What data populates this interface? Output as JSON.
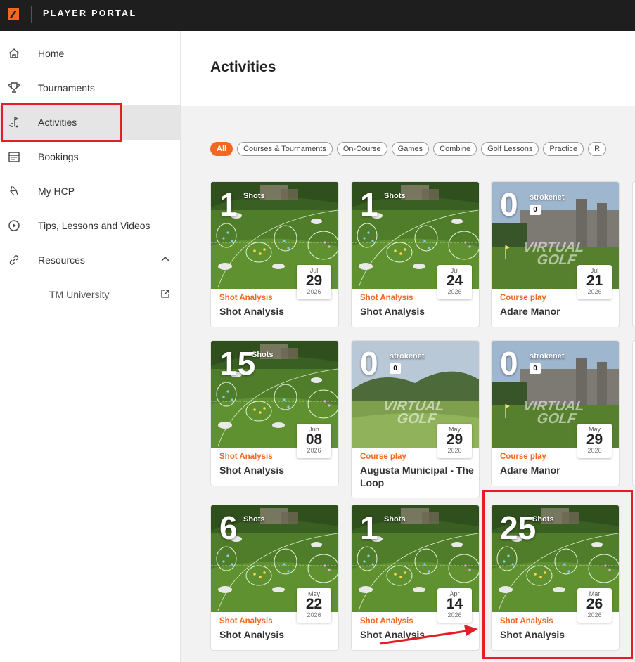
{
  "header": {
    "title": "PLAYER PORTAL",
    "logo_icon": "trackman-logo-icon",
    "brand_color": "#f26822"
  },
  "sidebar": {
    "items": [
      {
        "label": "Home",
        "icon": "home-icon"
      },
      {
        "label": "Tournaments",
        "icon": "trophy-icon"
      },
      {
        "label": "Activities",
        "icon": "activities-icon",
        "active": true
      },
      {
        "label": "Bookings",
        "icon": "calendar-icon"
      },
      {
        "label": "My HCP",
        "icon": "hcp-icon"
      },
      {
        "label": "Tips, Lessons and Videos",
        "icon": "play-circle-icon"
      },
      {
        "label": "Resources",
        "icon": "link-icon",
        "expanded": true
      }
    ],
    "subitems": [
      {
        "label": "TM University",
        "icon": "external-link-icon"
      }
    ]
  },
  "main": {
    "title": "Activities",
    "filters": [
      "All",
      "Courses & Tournaments",
      "On-Course",
      "Games",
      "Combine",
      "Golf Lessons",
      "Practice",
      "R"
    ],
    "cards": [
      {
        "type": "shots",
        "number": "1",
        "label": "Shots",
        "month": "Jul",
        "day": "29",
        "year": "2026",
        "category": "Shot Analysis",
        "name": "Shot Analysis"
      },
      {
        "type": "shots",
        "number": "1",
        "label": "Shots",
        "month": "Jul",
        "day": "24",
        "year": "2026",
        "category": "Shot Analysis",
        "name": "Shot Analysis"
      },
      {
        "type": "course",
        "number": "0",
        "label": "strokenet",
        "score": "0",
        "scene": "manor",
        "month": "Jul",
        "day": "21",
        "year": "2026",
        "category": "Course play",
        "name": "Adare Manor"
      },
      {
        "type": "shots",
        "number": "15",
        "label": "Shots",
        "month": "Jun",
        "day": "08",
        "year": "2026",
        "category": "Shot Analysis",
        "name": "Shot Analysis"
      },
      {
        "type": "course",
        "number": "0",
        "label": "strokenet",
        "score": "0",
        "scene": "augusta",
        "month": "May",
        "day": "29",
        "year": "2026",
        "category": "Course play",
        "name": "Augusta Municipal - The Loop"
      },
      {
        "type": "course",
        "number": "0",
        "label": "strokenet",
        "score": "0",
        "scene": "manor",
        "month": "May",
        "day": "29",
        "year": "2026",
        "category": "Course play",
        "name": "Adare Manor"
      },
      {
        "type": "shots",
        "number": "6",
        "label": "Shots",
        "month": "May",
        "day": "22",
        "year": "2026",
        "category": "Shot Analysis",
        "name": "Shot Analysis"
      },
      {
        "type": "shots",
        "number": "1",
        "label": "Shots",
        "month": "Apr",
        "day": "14",
        "year": "2026",
        "category": "Shot Analysis",
        "name": "Shot Analysis"
      },
      {
        "type": "shots",
        "number": "25",
        "label": "Shots",
        "month": "Mar",
        "day": "26",
        "year": "2026",
        "category": "Shot Analysis",
        "name": "Shot Analysis"
      }
    ],
    "virtual_golf_text": [
      "VIRTUAL",
      "GOLF"
    ]
  },
  "annotations": {
    "highlight_color": "#e41e26"
  }
}
